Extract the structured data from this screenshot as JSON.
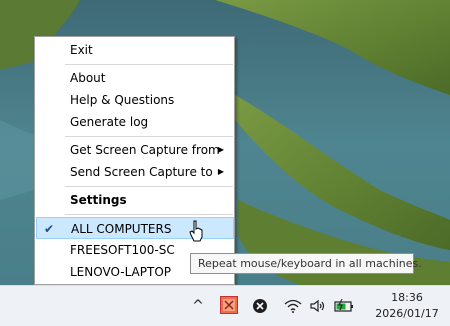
{
  "menu": {
    "items": {
      "exit": "Exit",
      "about": "About",
      "help": "Help & Questions",
      "generate_log": "Generate log",
      "get_capture": "Get Screen Capture from",
      "send_capture": "Send Screen Capture to",
      "settings": "Settings",
      "all_computers": "ALL COMPUTERS",
      "freesoft": "FREESOFT100-SC",
      "lenovo": "LENOVO-LAPTOP"
    },
    "check_glyph": "✔",
    "submenu_glyph": "▶"
  },
  "tooltip": {
    "text": "Repeat mouse/keyboard in all machines."
  },
  "taskbar": {
    "chevron_glyph": "^",
    "clock": {
      "time": "18:36",
      "date": "2026/01/17"
    }
  },
  "colors": {
    "accent_highlight": "#cce8ff",
    "accent_border": "#99d1ff",
    "water": "#3f6e7a",
    "grass": "#6f8f3a"
  }
}
